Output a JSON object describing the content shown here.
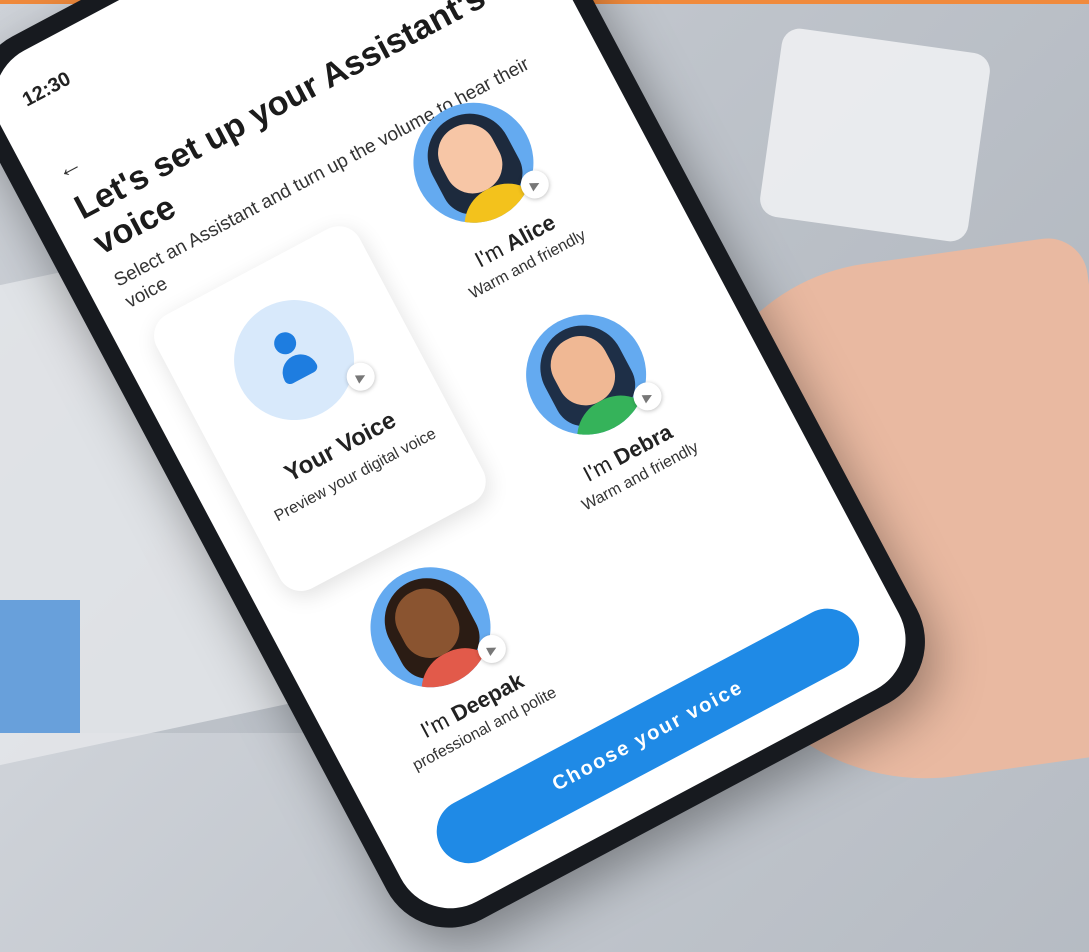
{
  "status_bar": {
    "time": "12:30"
  },
  "header": {
    "back_icon": "←",
    "title": "Let's set up your Assistant's voice",
    "subtitle": "Select an Assistant and turn up the volume to hear their voice"
  },
  "your_voice_card": {
    "title": "Your Voice",
    "description": "Preview your digital voice",
    "icon": "person-icon"
  },
  "assistants": [
    {
      "prefix": "I'm ",
      "name": "Alice",
      "description": "Warm and friendly",
      "hair": "#1d2a3d",
      "skin": "#f7c6a6",
      "shirt": "#f3c21c"
    },
    {
      "prefix": "I'm ",
      "name": "Debra",
      "description": "Warm and friendly",
      "hair": "#1e2f47",
      "skin": "#f0b894",
      "shirt": "#35b35a"
    },
    {
      "prefix": "I'm ",
      "name": "Deepak",
      "description": "professional and polite",
      "hair": "#2b1c14",
      "skin": "#8a5430",
      "shirt": "#e25a4a"
    }
  ],
  "play_glyph": "▶",
  "primary_action": {
    "label": "Choose your voice"
  },
  "colors": {
    "accent": "#1f8ae6",
    "avatar_bg": "#64aaf0",
    "card_circle": "#d8e9fb"
  }
}
